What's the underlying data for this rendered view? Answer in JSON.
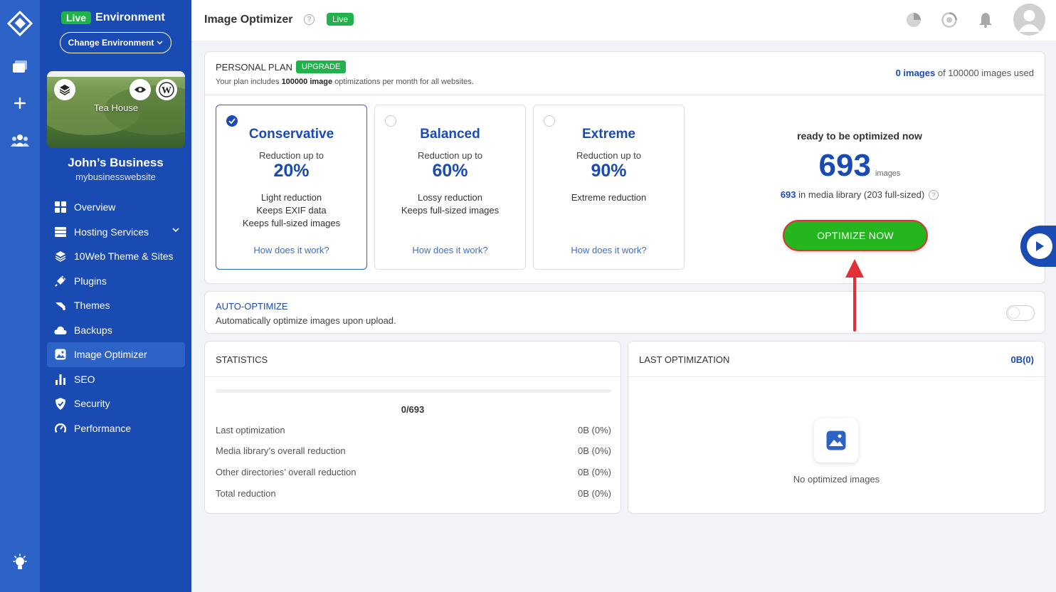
{
  "sidebar": {
    "env_live": "Live",
    "env_label": "Environment",
    "change_env": "Change Environment",
    "site_overlay": "Tea House",
    "business_name": "John’s Business",
    "website": "mybusinesswebsite",
    "items": [
      {
        "label": "Overview",
        "icon": "grid-icon"
      },
      {
        "label": "Hosting Services",
        "icon": "server-icon"
      },
      {
        "label": "10Web Theme & Sites",
        "icon": "layers-icon"
      },
      {
        "label": "Plugins",
        "icon": "plug-icon"
      },
      {
        "label": "Themes",
        "icon": "brush-icon"
      },
      {
        "label": "Backups",
        "icon": "cloud-icon"
      },
      {
        "label": "Image Optimizer",
        "icon": "image-icon"
      },
      {
        "label": "SEO",
        "icon": "bar-chart-icon"
      },
      {
        "label": "Security",
        "icon": "shield-icon"
      },
      {
        "label": "Performance",
        "icon": "gauge-icon"
      }
    ],
    "active_item": "Image Optimizer"
  },
  "header": {
    "title": "Image Optimizer",
    "help": "?",
    "live": "Live"
  },
  "plan": {
    "name": "PERSONAL PLAN",
    "upgrade": "UPGRADE",
    "desc_prefix": "Your plan includes",
    "desc_count": "100000 image",
    "desc_suffix": "optimizations per month for all websites.",
    "used_count": "0 images",
    "used_suffix": "of 100000 images used"
  },
  "modes": [
    {
      "title": "Conservative",
      "sub": "Reduction up to",
      "pct": "20%",
      "desc": [
        "Light reduction",
        "Keeps EXIF data",
        "Keeps full-sized images"
      ],
      "link": "How does it work?",
      "selected": true
    },
    {
      "title": "Balanced",
      "sub": "Reduction up to",
      "pct": "60%",
      "desc": [
        "Lossy reduction",
        "Keeps full-sized images"
      ],
      "link": "How does it work?",
      "selected": false
    },
    {
      "title": "Extreme",
      "sub": "Reduction up to",
      "pct": "90%",
      "desc": [
        "Extreme reduction"
      ],
      "link": "How does it work?",
      "selected": false
    }
  ],
  "ready": {
    "title": "ready to be optimized now",
    "count": "693",
    "unit": "images",
    "lib_count": "693",
    "lib_suffix": "in media library (203 full-sized)",
    "help": "?",
    "button": "OPTIMIZE NOW"
  },
  "auto": {
    "title": "AUTO-OPTIMIZE",
    "desc": "Automatically optimize images upon upload.",
    "enabled": false
  },
  "stats": {
    "title": "STATISTICS",
    "progress_fraction": 0,
    "progress_label": "0/693",
    "rows": [
      {
        "label": "Last optimization",
        "value": "0B (0%)"
      },
      {
        "label": "Media library’s overall reduction",
        "value": "0B (0%)"
      },
      {
        "label": "Other directories’ overall reduction",
        "value": "0B (0%)"
      },
      {
        "label": "Total reduction",
        "value": "0B (0%)"
      }
    ]
  },
  "last": {
    "title": "LAST OPTIMIZATION",
    "summary": "0B(0)",
    "empty": "No optimized images"
  },
  "colors": {
    "primary": "#1a4bb3",
    "rail": "#2d62c7",
    "live_green": "#21b24b",
    "optimize_green": "#25b51f",
    "highlight_red": "#e2303a"
  }
}
